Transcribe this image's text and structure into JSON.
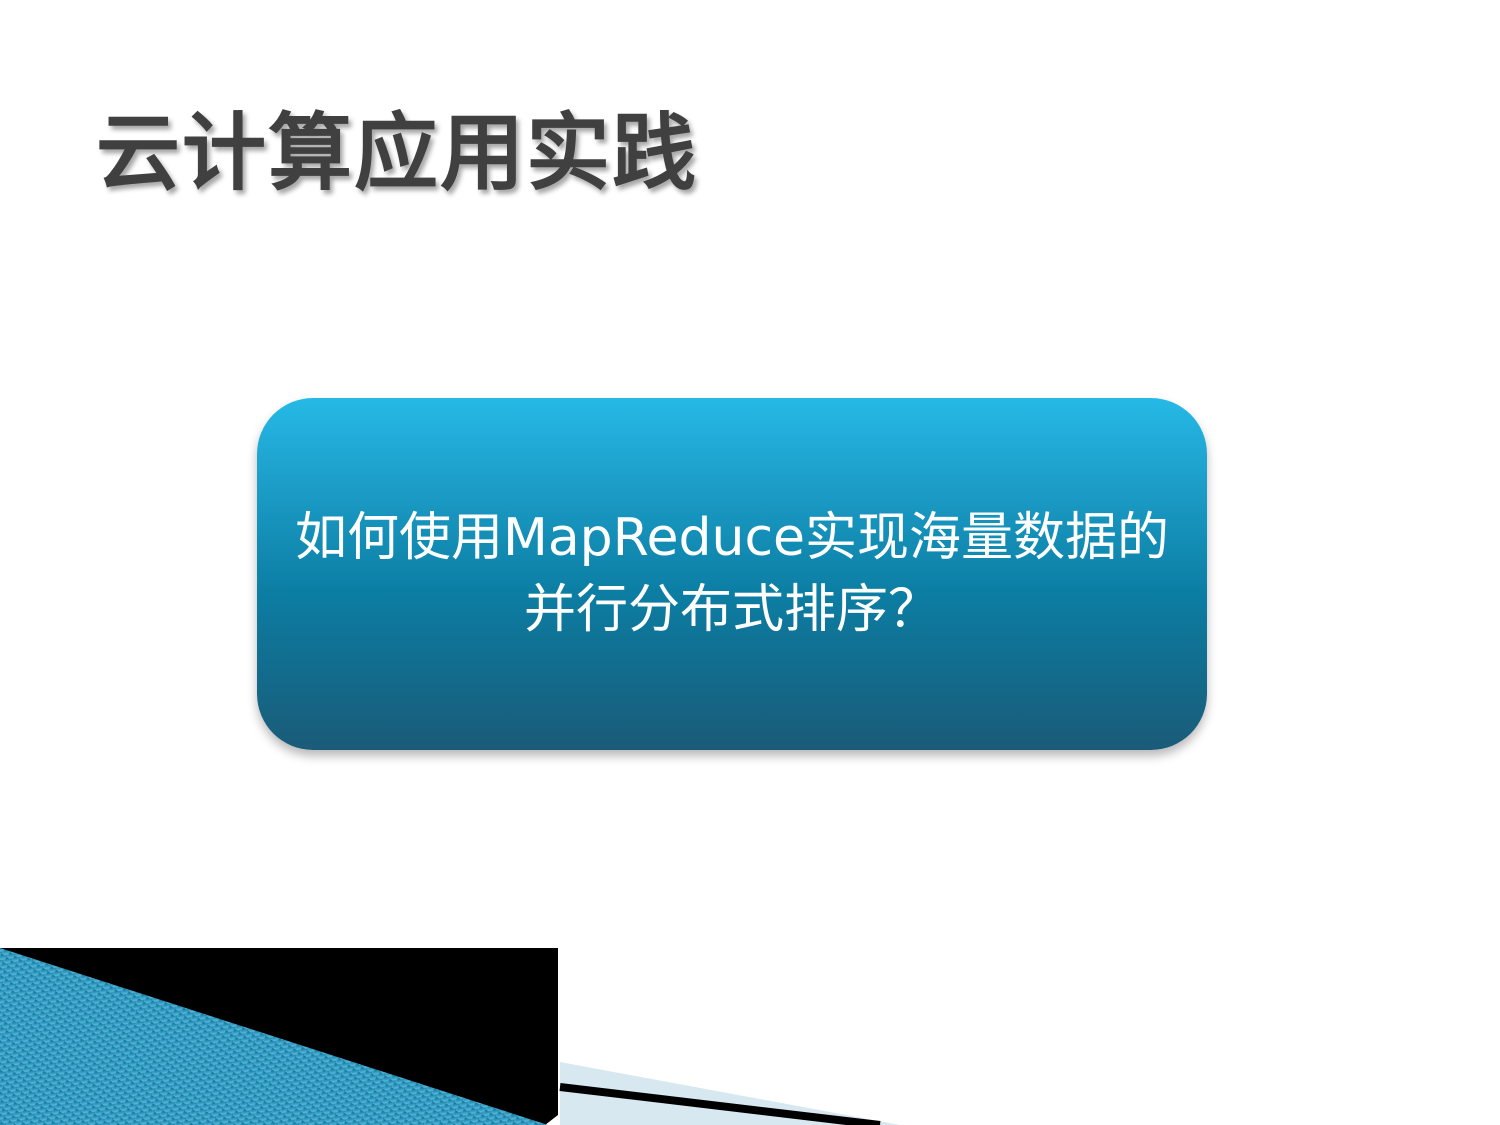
{
  "slide": {
    "title": "云计算应用实践",
    "question": "如何使用MapReduce实现海量数据的并行分布式排序？"
  },
  "colors": {
    "title_text": "#404040",
    "box_top": "#26b9e6",
    "box_bottom": "#1a5b78",
    "question_text": "#ffffff",
    "decor_black": "#000000",
    "decor_blue": "#1f8fb5",
    "decor_light": "#d8e8f0"
  }
}
